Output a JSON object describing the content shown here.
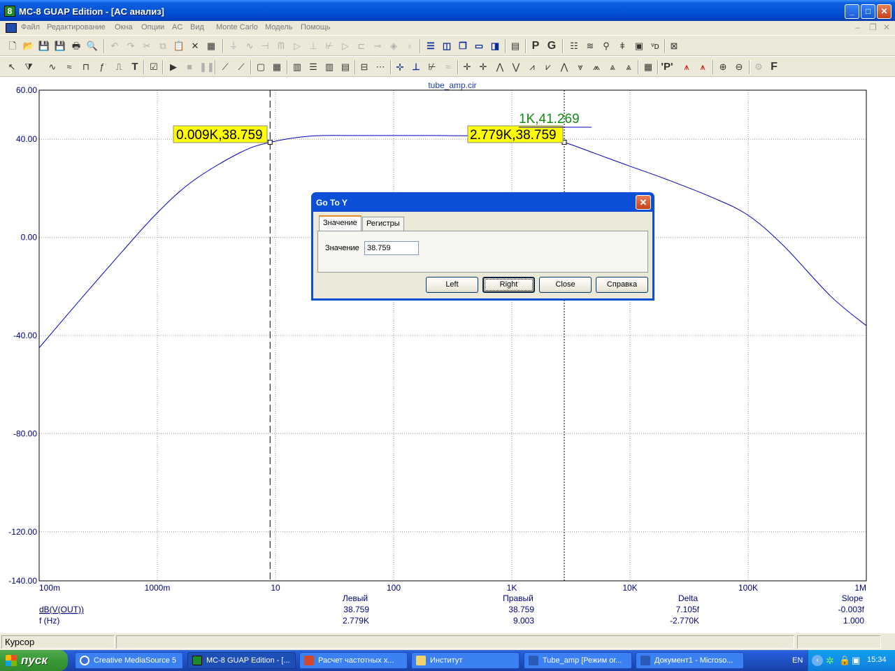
{
  "window": {
    "title": "MC-8 GUAP Edition - [AC анализ]",
    "app_icon": "8"
  },
  "menu": [
    "Файл",
    "Редактирование",
    "Окна",
    "Опции",
    "AC",
    "Вид",
    "Monte Carlo",
    "Модель",
    "Помощь"
  ],
  "toolbar1_text": {
    "p_button": "P",
    "g_button": "G"
  },
  "toolbar2_text": {
    "text_tool": "T",
    "p_tool": "'P'",
    "f_tool": "F"
  },
  "plot": {
    "title": "tube_amp.cir",
    "cursor_left_label": "0.009K,38.759",
    "cursor_right_label": "2.779K,38.759",
    "peak_label": "1K,41.269"
  },
  "chart_data": {
    "type": "line",
    "title": "tube_amp.cir",
    "xscale": "log",
    "xlim": [
      0.1,
      1000000
    ],
    "ylim": [
      -140,
      60
    ],
    "grid": true,
    "x_ticks": [
      {
        "value": 0.1,
        "label": "100m"
      },
      {
        "value": 1,
        "label": "1000m"
      },
      {
        "value": 10,
        "label": "10"
      },
      {
        "value": 100,
        "label": "100"
      },
      {
        "value": 1000,
        "label": "1K"
      },
      {
        "value": 10000,
        "label": "10K"
      },
      {
        "value": 100000,
        "label": "100K"
      },
      {
        "value": 1000000,
        "label": "1M"
      }
    ],
    "y_ticks": [
      {
        "value": 60,
        "label": "60.00"
      },
      {
        "value": 40,
        "label": "40.00"
      },
      {
        "value": 0,
        "label": "0.00"
      },
      {
        "value": -40,
        "label": "-40.00"
      },
      {
        "value": -80,
        "label": "-80.00"
      },
      {
        "value": -120,
        "label": "-120.00"
      },
      {
        "value": -140,
        "label": "-140.00"
      }
    ],
    "series": [
      {
        "name": "dB(V(OUT))",
        "color": "#0000c0",
        "x": [
          0.1,
          0.2,
          0.5,
          1,
          2,
          5,
          9,
          20,
          50,
          100,
          200,
          500,
          1000,
          2000,
          2779,
          5000,
          10000,
          20000,
          50000,
          100000,
          200000,
          500000,
          1000000
        ],
        "y": [
          -45,
          -28,
          -6,
          10,
          23,
          34.5,
          38.76,
          41.3,
          41.5,
          41.5,
          41.5,
          41.4,
          41.27,
          40.1,
          38.76,
          34.3,
          29,
          23.8,
          16.2,
          9,
          -3.5,
          -24,
          -36
        ]
      }
    ],
    "cursors": [
      {
        "x": 9,
        "y": 38.759,
        "style": "dashed"
      },
      {
        "x": 2779,
        "y": 38.759,
        "style": "dotted"
      }
    ],
    "peak_marker": {
      "x": 1000,
      "y": 41.269
    }
  },
  "readout": {
    "headers": [
      "Левый",
      "Правый",
      "Delta",
      "Slope"
    ],
    "rows": [
      {
        "name": "dB(V(OUT))",
        "values": [
          "38.759",
          "38.759",
          "7.105f",
          "-0.003f"
        ]
      },
      {
        "name": "f (Hz)",
        "values": [
          "2.779K",
          "9.003",
          "-2.770K",
          "1.000"
        ]
      }
    ]
  },
  "status": {
    "mode": "Курсор"
  },
  "dialog": {
    "title": "Go To Y",
    "tabs": [
      "Значение",
      "Регистры"
    ],
    "field_label": "Значение",
    "field_value": "38.759",
    "buttons": [
      "Left",
      "Right",
      "Close",
      "Справка"
    ]
  },
  "taskbar": {
    "start": "пуск",
    "tasks": [
      "Creative MediaSource 5",
      "MC-8 GUAP Edition - [...",
      "Расчет частотных х...",
      "Институт",
      "Tube_amp [Режим ог...",
      "Документ1 - Microso..."
    ],
    "lang": "EN",
    "clock": "15:34"
  }
}
